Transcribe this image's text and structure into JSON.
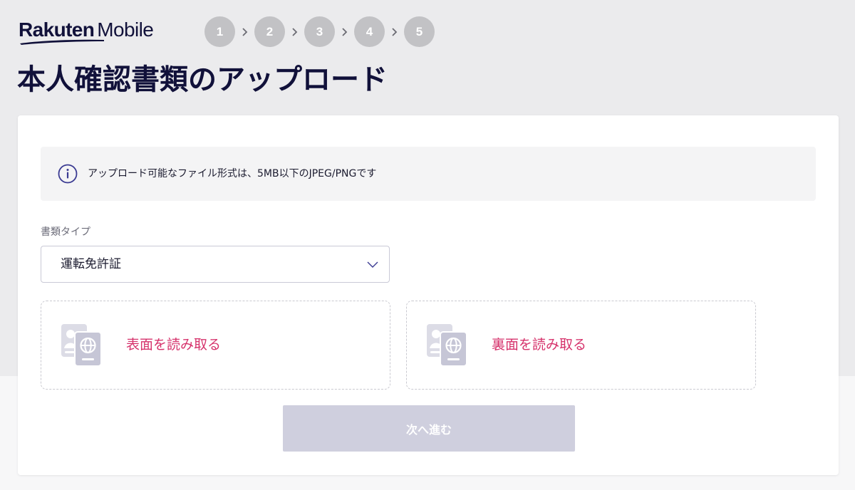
{
  "header": {
    "logo": {
      "brand": "Rakuten",
      "product": "Mobile"
    },
    "steps": [
      {
        "label": "1",
        "active": true
      },
      {
        "label": "2",
        "active": false
      },
      {
        "label": "3",
        "active": false
      },
      {
        "label": "4",
        "active": false
      },
      {
        "label": "5",
        "active": false
      }
    ],
    "step_separator_icon": "chevron-right-icon",
    "title": "本人確認書類のアップロード"
  },
  "notice": {
    "icon": "info-icon",
    "text": "アップロード可能なファイル形式は、5MB以下のJPEG/PNGです"
  },
  "document_type": {
    "label": "書類タイプ",
    "selected_value": "運転免許証",
    "icon": "chevron-down-icon"
  },
  "uploads": {
    "icon": "id-documents-icon",
    "front_label": "表面を読み取る",
    "back_label": "裏面を読み取る"
  },
  "next_button": {
    "label": "次へ進む",
    "enabled": false
  },
  "colors": {
    "brand_navy": "#11113a",
    "active_step": "#3a3a92",
    "inactive_step": "#c2c2c5",
    "upload_link": "#d6336c",
    "disabled_button": "#cfcfde",
    "page_background": "#ebebed"
  }
}
